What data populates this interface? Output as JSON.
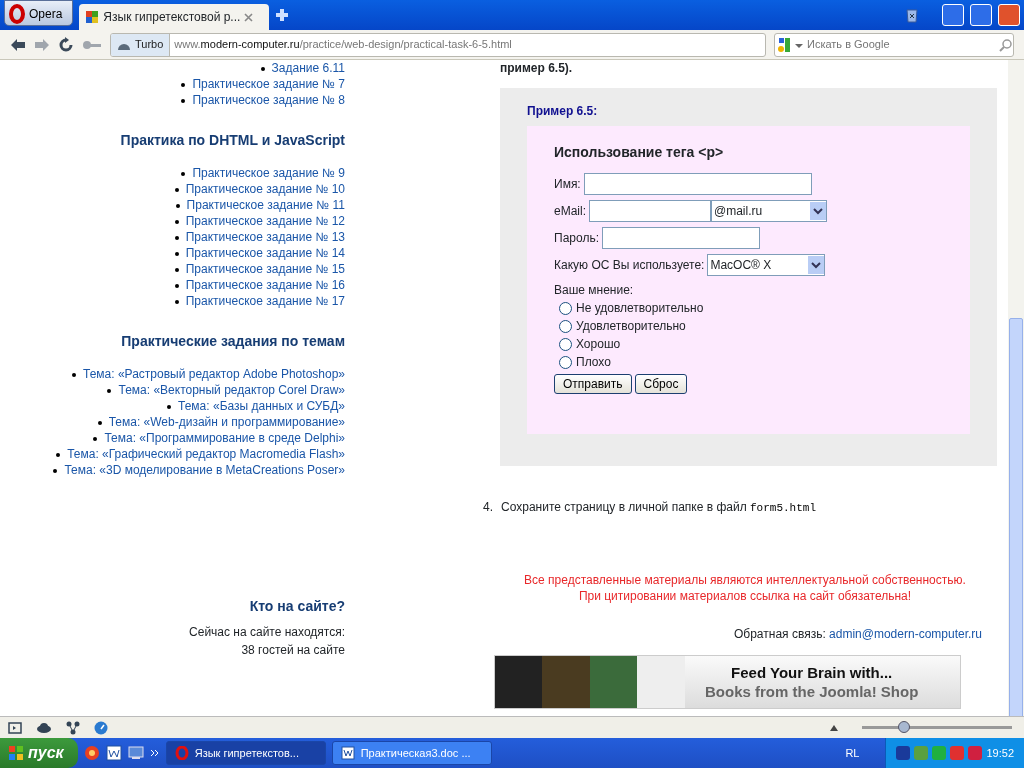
{
  "browser": {
    "menu_button": "Opera",
    "tabs": [
      {
        "title": "Язык гипретекстовой р...",
        "selected": true
      }
    ],
    "turbo": "Turbo",
    "url": {
      "host_prefix": "www.",
      "host": "modern-computer.ru",
      "path": "/practice/web-design/practical-task-6-5.html"
    },
    "search": {
      "placeholder": "Искать в Google"
    }
  },
  "sidebar": {
    "top_items": [
      "Задание 6.11",
      "Практическое задание № 7",
      "Практическое задание № 8"
    ],
    "sections": [
      {
        "heading": "Практика по DHTML и JavaScript",
        "items": [
          "Практическое задание № 9",
          "Практическое задание № 10",
          "Практическое задание № 11",
          "Практическое задание № 12",
          "Практическое задание № 13",
          "Практическое задание № 14",
          "Практическое задание № 15",
          "Практическое задание № 16",
          "Практическое задание № 17"
        ]
      },
      {
        "heading": "Практические задания по темам",
        "items": [
          "Тема: «Растровый редактор Adobe Photoshop»",
          "Тема: «Векторный редактор Corel Draw»",
          "Тема: «Базы данных и СУБД»",
          "Тема: «Web-дизайн и программирование»",
          "Тема: «Программирование в среде Delphi»",
          "Тема: «Графический редактор Macromedia Flash»",
          "Тема: «3D моделирование в MetaCreations Poser»"
        ]
      }
    ],
    "online": {
      "heading": "Кто на сайте?",
      "line1": "Сейчас на сайте находятся:",
      "line2": "38 гостей на сайте"
    }
  },
  "article": {
    "top_text": "пример 6.5).",
    "example": {
      "caption": "Пример 6.5:",
      "title": "Использование тега <p>",
      "fields": [
        {
          "kind": "text",
          "label": "Имя:"
        },
        {
          "kind": "email",
          "label": "eMail:",
          "domain": "@mail.ru"
        },
        {
          "kind": "password",
          "label": "Пароль:"
        },
        {
          "kind": "select",
          "label": "Какую ОС Вы используете:",
          "value": "MacOC® X"
        }
      ],
      "opinion_label": "Ваше мнение:",
      "radios": [
        {
          "label": "Не удовлетворительно",
          "selected": false
        },
        {
          "label": "Удовлетворительно",
          "selected": false
        },
        {
          "label": "Хорошо",
          "selected": false
        },
        {
          "label": "Плохо",
          "selected": false
        }
      ],
      "buttons": [
        "Отправить",
        "Сброс"
      ]
    },
    "step": {
      "number": "4.",
      "text": "Сохраните страницу в личной папке в файл",
      "file": "form5.html"
    },
    "notice": [
      "Все представленные материалы являются интеллектуальной собственностью.",
      "При цитировании материалов ссылка на сайт обязательна!"
    ],
    "feedback": {
      "label": "Обратная связь:",
      "email": "admin@modern-computer.ru"
    },
    "banner": {
      "line1": "Feed Your Brain with...",
      "line2": "Books from the Joomla! Shop"
    }
  },
  "status_bar": {
    "zoom": {
      "level": 0.28
    }
  },
  "taskbar": {
    "start": "пуск",
    "tasks": [
      {
        "title": "Язык гипретекстов...",
        "selected": true
      },
      {
        "title": "Практическая3.doc ...",
        "selected": false
      }
    ],
    "language": "RL",
    "clock": "19:52"
  }
}
